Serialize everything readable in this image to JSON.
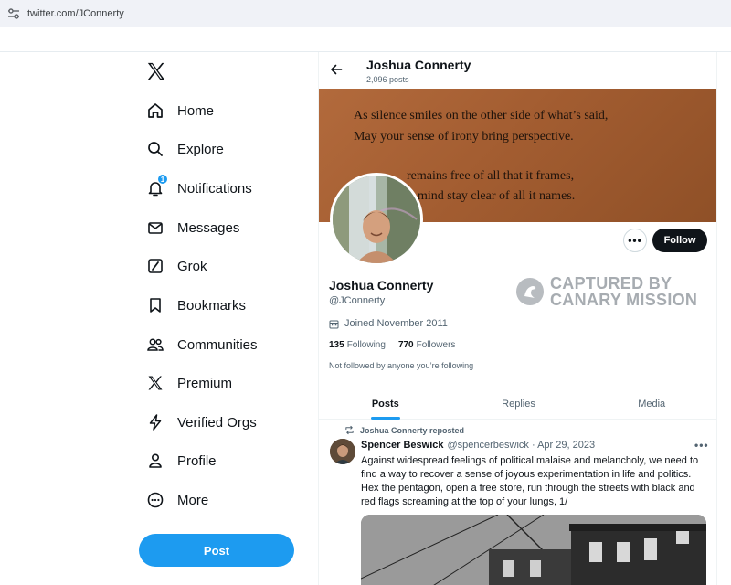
{
  "browser": {
    "url": "twitter.com/JConnerty"
  },
  "nav": {
    "items": [
      {
        "label": "Home",
        "icon": "home-icon"
      },
      {
        "label": "Explore",
        "icon": "search-icon"
      },
      {
        "label": "Notifications",
        "icon": "bell-icon",
        "badge": "1"
      },
      {
        "label": "Messages",
        "icon": "envelope-icon"
      },
      {
        "label": "Grok",
        "icon": "grok-icon"
      },
      {
        "label": "Bookmarks",
        "icon": "bookmark-icon"
      },
      {
        "label": "Communities",
        "icon": "people-icon"
      },
      {
        "label": "Premium",
        "icon": "x-logo-icon"
      },
      {
        "label": "Verified Orgs",
        "icon": "lightning-icon"
      },
      {
        "label": "Profile",
        "icon": "person-icon"
      },
      {
        "label": "More",
        "icon": "more-circle-icon"
      }
    ],
    "post_label": "Post"
  },
  "header": {
    "name": "Joshua Connerty",
    "posts_count": "2,096 posts"
  },
  "banner": {
    "lines": [
      "As silence smiles on the other side of what’s said,",
      "May your sense of irony bring perspective.",
      "remains free of all that it frames,",
      "mind stay clear of all it names."
    ]
  },
  "profile": {
    "name": "Joshua Connerty",
    "handle": "@JConnerty",
    "joined": "Joined November 2011",
    "following_count": "135",
    "following_label": "Following",
    "followers_count": "770",
    "followers_label": "Followers",
    "not_followed": "Not followed by anyone you’re following",
    "follow_label": "Follow"
  },
  "watermark": {
    "line1": "CAPTURED BY",
    "line2": "CANARY MISSION"
  },
  "tabs": [
    "Posts",
    "Replies",
    "Media"
  ],
  "active_tab": "Posts",
  "tweet": {
    "reposted_by": "Joshua Connerty reposted",
    "author_name": "Spencer Beswick",
    "author_handle": "@spencerbeswick · Apr 29, 2023",
    "text": "Against widespread feelings of political malaise and melancholy, we need to find a way to recover a sense of joyous experimentation in life and politics. Hex the pentagon, open a free store, run through the streets with black and red flags screaming at the top of your lungs, 1/"
  },
  "colors": {
    "accent": "#1d9bf0",
    "text": "#0f1419",
    "muted": "#536471",
    "banner": "#a35d31"
  }
}
